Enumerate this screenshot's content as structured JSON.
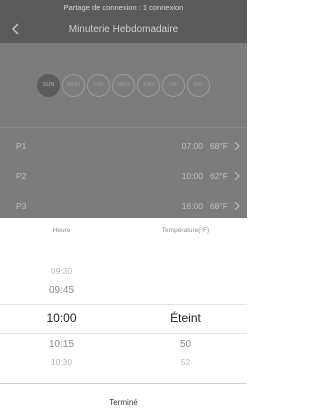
{
  "status_bar": {
    "text": "Partage de connexion : 1 connexion"
  },
  "nav": {
    "title": "Minuterie Hebdomadaire",
    "back_icon": "chevron-left-icon"
  },
  "days": [
    {
      "label": "SUN",
      "selected": true
    },
    {
      "label": "MON",
      "selected": false
    },
    {
      "label": "TUE",
      "selected": false
    },
    {
      "label": "WED",
      "selected": false
    },
    {
      "label": "THU",
      "selected": false
    },
    {
      "label": "FRI",
      "selected": false
    },
    {
      "label": "SAT",
      "selected": false
    }
  ],
  "periods": [
    {
      "name": "P1",
      "time": "07:00",
      "temp": "68°F"
    },
    {
      "name": "P2",
      "time": "10:00",
      "temp": "62°F"
    },
    {
      "name": "P3",
      "time": "16:00",
      "temp": "68°F"
    }
  ],
  "picker": {
    "col_hour": "Heure",
    "col_temp": "Température(°F)",
    "hour_values": [
      "09:30",
      "09:45",
      "10:00",
      "10:15",
      "10:30"
    ],
    "temp_values": [
      "",
      "",
      "Éteint",
      "50",
      "52"
    ],
    "selected_hour": "10:00",
    "selected_temp": "Éteint"
  },
  "done_label": "Terminé"
}
